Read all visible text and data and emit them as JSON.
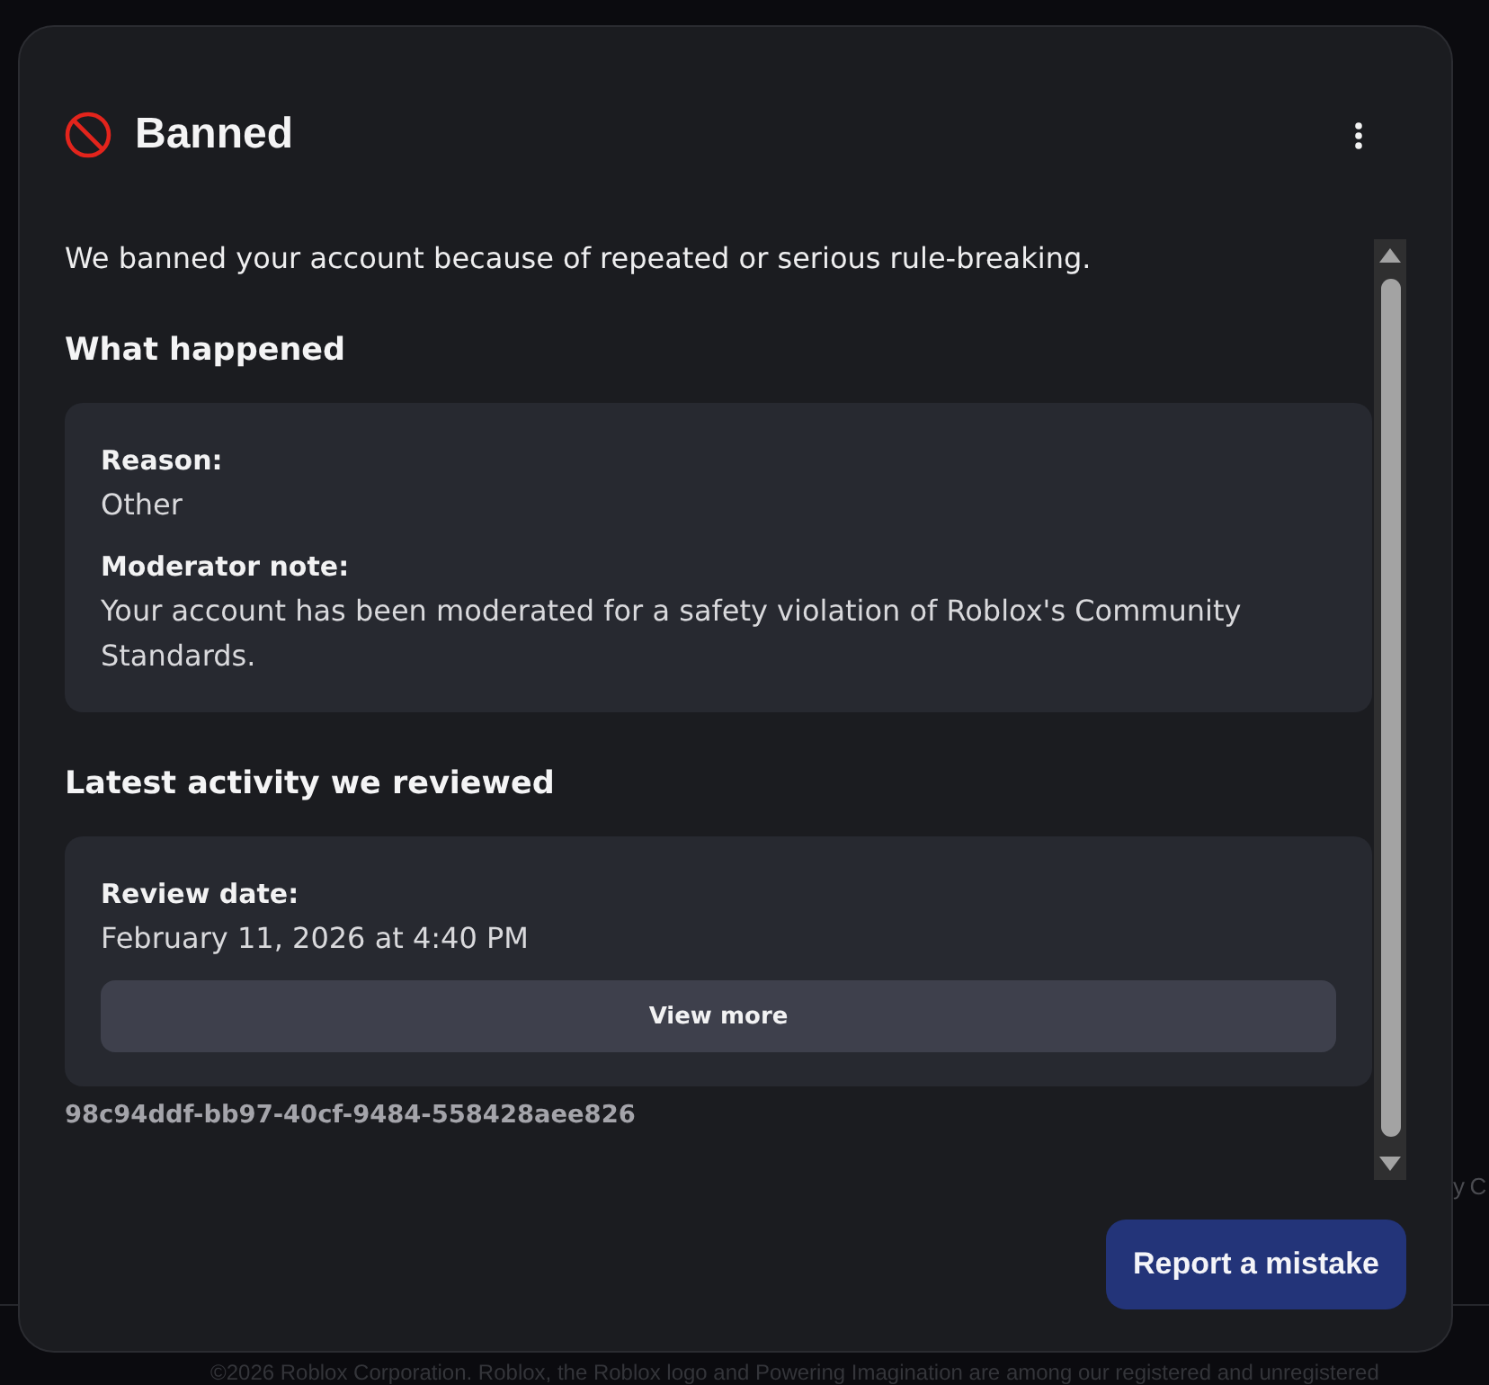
{
  "page_background": {
    "footer_link_fragment": "y C",
    "copyright": "©2026 Roblox Corporation. Roblox, the Roblox logo and Powering Imagination are among our registered and unregistered"
  },
  "dialog": {
    "title": "Banned",
    "intro": "We banned your account because of repeated or serious rule-breaking.",
    "sections": [
      {
        "heading": "What happened",
        "card": {
          "fields": [
            {
              "label": "Reason:",
              "value": "Other"
            },
            {
              "label": "Moderator note:",
              "value": "Your account has been moderated for a safety violation of Roblox's Community Standards."
            }
          ]
        }
      },
      {
        "heading": "Latest activity we reviewed",
        "card": {
          "fields": [
            {
              "label": "Review date:",
              "value": "February 11, 2026 at 4:40 PM"
            }
          ],
          "button": "View more"
        }
      }
    ],
    "reference_id": "98c94ddf-bb97-40cf-9484-558428aee826",
    "buttons": [
      "Report a mistake"
    ]
  }
}
